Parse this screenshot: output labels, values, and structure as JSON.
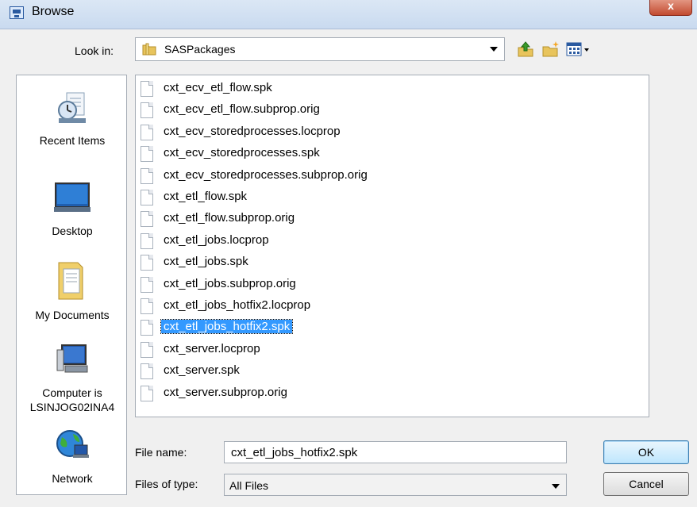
{
  "window": {
    "title": "Browse",
    "close_label": "x"
  },
  "lookin": {
    "label": "Look in:",
    "value": "SASPackages"
  },
  "toolbar": {
    "icons": [
      "up-folder-icon",
      "new-folder-icon",
      "view-menu-icon"
    ]
  },
  "places": [
    {
      "label": "Recent Items",
      "icon": "recent-items-icon"
    },
    {
      "label": "Desktop",
      "icon": "desktop-icon"
    },
    {
      "label": "My Documents",
      "icon": "my-documents-icon"
    },
    {
      "label": "Computer is\nLSINJOG02INA4",
      "line1": "Computer is",
      "line2": "LSINJOG02INA4",
      "icon": "computer-icon"
    },
    {
      "label": "Network",
      "icon": "network-icon"
    }
  ],
  "files": [
    "cxt_ecv_etl_flow.spk",
    "cxt_ecv_etl_flow.subprop.orig",
    "cxt_ecv_storedprocesses.locprop",
    "cxt_ecv_storedprocesses.spk",
    "cxt_ecv_storedprocesses.subprop.orig",
    "cxt_etl_flow.spk",
    "cxt_etl_flow.subprop.orig",
    "cxt_etl_jobs.locprop",
    "cxt_etl_jobs.spk",
    "cxt_etl_jobs.subprop.orig",
    "cxt_etl_jobs_hotfix2.locprop",
    "cxt_etl_jobs_hotfix2.spk",
    "cxt_server.locprop",
    "cxt_server.spk",
    "cxt_server.subprop.orig"
  ],
  "selected_file_index": 11,
  "filename": {
    "label": "File name:",
    "value": "cxt_etl_jobs_hotfix2.spk"
  },
  "filetype": {
    "label": "Files of type:",
    "value": "All Files"
  },
  "buttons": {
    "ok": "OK",
    "cancel": "Cancel"
  },
  "colors": {
    "selection": "#3399ff",
    "titlebar": "#c9daef"
  }
}
